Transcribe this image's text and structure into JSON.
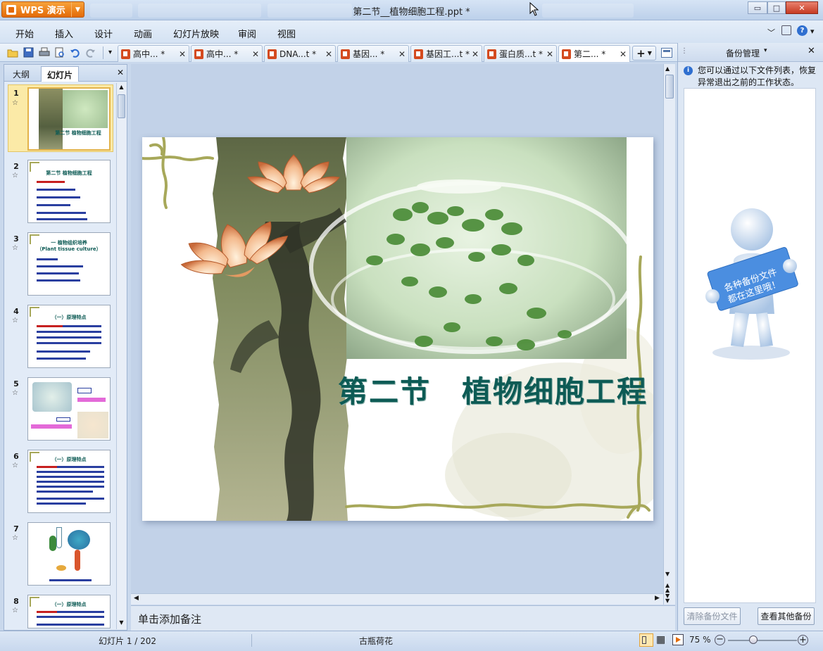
{
  "window": {
    "title": "第二节__植物细胞工程.ppt *",
    "app_label": "WPS 演示",
    "min_glyph": "▭",
    "max_glyph": "□",
    "close_glyph": "✕"
  },
  "menu": {
    "items": [
      "开始",
      "插入",
      "设计",
      "动画",
      "幻灯片放映",
      "审阅",
      "视图"
    ]
  },
  "doc_tabs": [
    {
      "label": "高中... *",
      "active": false
    },
    {
      "label": "高中... *",
      "active": false
    },
    {
      "label": "DNA...t *",
      "active": false
    },
    {
      "label": "基因... *",
      "active": false
    },
    {
      "label": "基因工...t *",
      "active": false
    },
    {
      "label": "蛋白质...t *",
      "active": false
    },
    {
      "label": "第二... *",
      "active": true
    }
  ],
  "left_panel": {
    "tabs": [
      "大纲",
      "幻灯片"
    ],
    "active_tab": "幻灯片",
    "thumb_titles": {
      "2": "第二节 植物细胞工程",
      "3": "一 植物组织培养",
      "3b": "（Plant tissue culture）",
      "4": "（一）原理特点",
      "6": "（一）原理特点",
      "8": "（一）原理特点",
      "1": "第二节 植物细胞工程"
    },
    "slide_numbers": [
      "1",
      "2",
      "3",
      "4",
      "5",
      "6",
      "7",
      "8"
    ]
  },
  "slide": {
    "title": "第二节　植物细胞工程"
  },
  "notes": {
    "placeholder": "单击添加备注"
  },
  "right_panel": {
    "title": "备份管理",
    "info": "您可以通过以下文件列表，恢复异常退出之前的工作状态。",
    "sign_text_line1": "各种备份文件",
    "sign_text_line2": "都在这里哦！",
    "clear_button": "清除备份文件",
    "view_button": "查看其他备份"
  },
  "status": {
    "slide_counter": "幻灯片 1 / 202",
    "theme": "古瓶荷花",
    "zoom": "75 %"
  },
  "colors": {
    "accent_orange": "#e36a08",
    "title_teal": "#0d5b55",
    "frame_olive": "#a7a85a"
  }
}
